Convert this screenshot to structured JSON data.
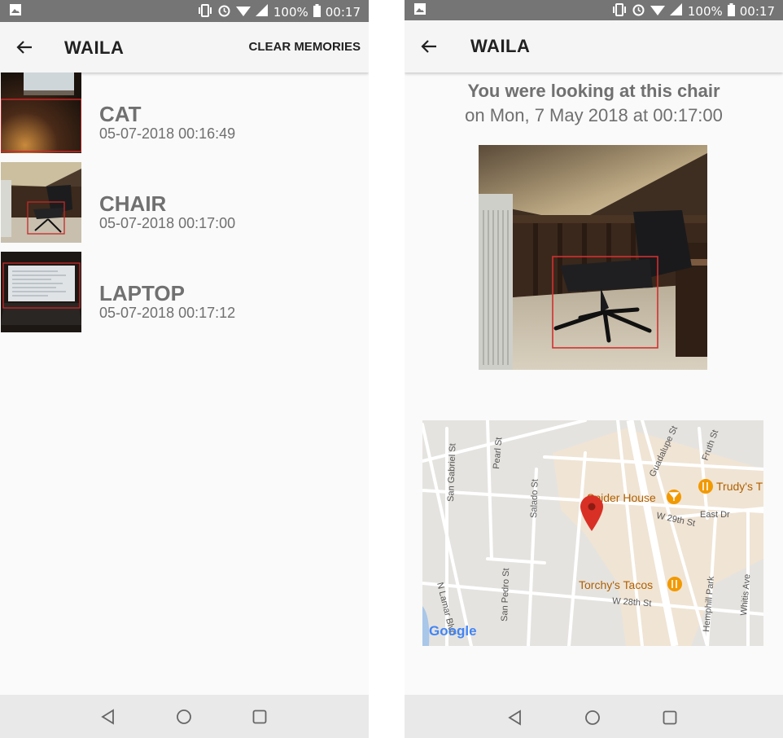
{
  "status_bar": {
    "battery": "100%",
    "time": "00:17"
  },
  "list_screen": {
    "title": "WAILA",
    "clear_label": "CLEAR MEMORIES",
    "items": [
      {
        "label": "CAT",
        "timestamp": "05-07-2018 00:16:49"
      },
      {
        "label": "CHAIR",
        "timestamp": "05-07-2018 00:17:00"
      },
      {
        "label": "LAPTOP",
        "timestamp": "05-07-2018 00:17:12"
      }
    ]
  },
  "detail_screen": {
    "title": "WAILA",
    "heading": "You were looking at this chair",
    "date_line": "on Mon, 7 May 2018 at 00:17:00",
    "map": {
      "streets": [
        "San Gabriel St",
        "Pearl St",
        "Salado St",
        "San Pedro St",
        "N Lamar Blvd",
        "Guadalupe St",
        "Fruth St",
        "W 29th St",
        "East Dr",
        "W 28th St",
        "Hemphill Park",
        "Whitis Ave"
      ],
      "places": [
        "Spider House",
        "Trudy's T",
        "Torchy's Tacos"
      ],
      "attribution": "Google"
    }
  },
  "colors": {
    "status_bar": "#757575",
    "app_bar": "#f5f5f5",
    "nav_bar": "#e9e9e9",
    "text_primary": "#212121",
    "text_secondary": "#707070",
    "detection_box": "#d32f2f",
    "map_pin": "#d93025",
    "place_icon": "#f29900"
  },
  "icons": [
    "image-icon",
    "vibrate-icon",
    "alarm-icon",
    "wifi-icon",
    "signal-icon",
    "battery-icon",
    "back-arrow-icon",
    "nav-back-icon",
    "nav-home-icon",
    "nav-recents-icon",
    "map-pin-icon",
    "restaurant-icon",
    "bar-icon"
  ]
}
